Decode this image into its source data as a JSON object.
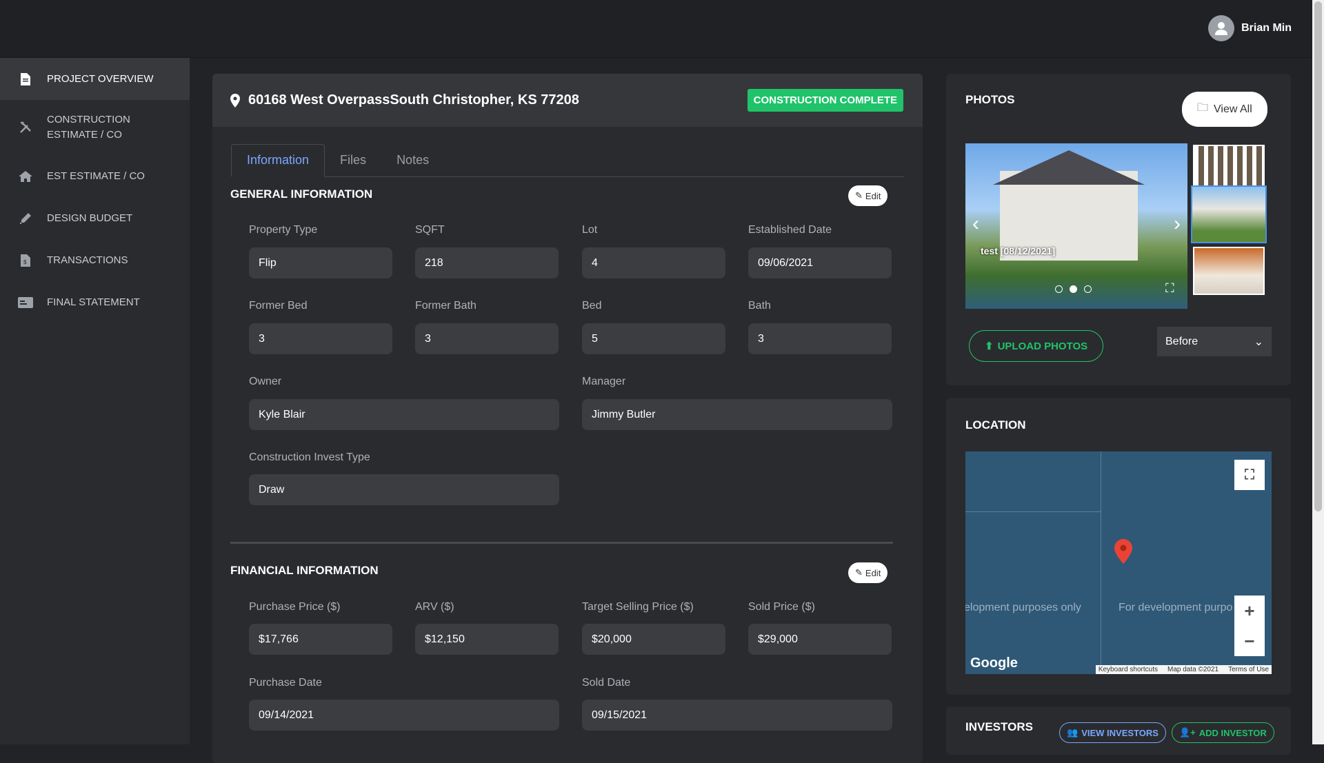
{
  "user": {
    "name": "Brian Min"
  },
  "sidebar": {
    "items": [
      {
        "label": "PROJECT OVERVIEW"
      },
      {
        "label": "CONSTRUCTION"
      },
      {
        "label": "ESTIMATE / CO"
      },
      {
        "label": "EST ESTIMATE / CO"
      },
      {
        "label": "DESIGN BUDGET"
      },
      {
        "label": "TRANSACTIONS"
      },
      {
        "label": "FINAL STATEMENT"
      }
    ]
  },
  "project": {
    "address": "60168 West OverpassSouth Christopher, KS 77208",
    "status": "CONSTRUCTION COMPLETE"
  },
  "tabs": [
    "Information",
    "Files",
    "Notes"
  ],
  "general": {
    "title": "GENERAL INFORMATION",
    "edit": "Edit",
    "fields": [
      {
        "label": "Property Type",
        "value": "Flip"
      },
      {
        "label": "SQFT",
        "value": "218"
      },
      {
        "label": "Lot",
        "value": "4"
      },
      {
        "label": "Established Date",
        "value": "09/06/2021"
      },
      {
        "label": "Former Bed",
        "value": "3"
      },
      {
        "label": "Former Bath",
        "value": "3"
      },
      {
        "label": "Bed",
        "value": "5"
      },
      {
        "label": "Bath",
        "value": "3"
      },
      {
        "label": "Owner",
        "value": "Kyle Blair"
      },
      {
        "label": "Manager",
        "value": "Jimmy Butler"
      },
      {
        "label": "Construction Invest Type",
        "value": "Draw"
      }
    ]
  },
  "financial": {
    "title": "FINANCIAL INFORMATION",
    "edit": "Edit",
    "fields": [
      {
        "label": "Purchase Price ($)",
        "value": "$17,766"
      },
      {
        "label": "ARV ($)",
        "value": "$12,150"
      },
      {
        "label": "Target Selling Price ($)",
        "value": "$20,000"
      },
      {
        "label": "Sold Price ($)",
        "value": "$29,000"
      },
      {
        "label": "Purchase Date",
        "value": "09/14/2021"
      },
      {
        "label": "Sold Date",
        "value": "09/15/2021"
      }
    ]
  },
  "photos": {
    "title": "PHOTOS",
    "view_all": "View All",
    "caption": "test [08/12/2021]",
    "upload": "UPLOAD PHOTOS",
    "filter": "Before",
    "active_slide": 2,
    "slide_count": 3
  },
  "location": {
    "title": "LOCATION",
    "dev_text_left": "elopment purposes only",
    "dev_text_right": "For development purpo",
    "google": "Google",
    "footer": [
      "Keyboard shortcuts",
      "Map data ©2021",
      "Terms of Use"
    ]
  },
  "investors": {
    "title": "INVESTORS",
    "view": "VIEW INVESTORS",
    "add": "ADD INVESTOR"
  },
  "colors": {
    "accent_green": "#20c36a",
    "tab_active": "#7aa7ff",
    "pin": "#ea4335"
  }
}
